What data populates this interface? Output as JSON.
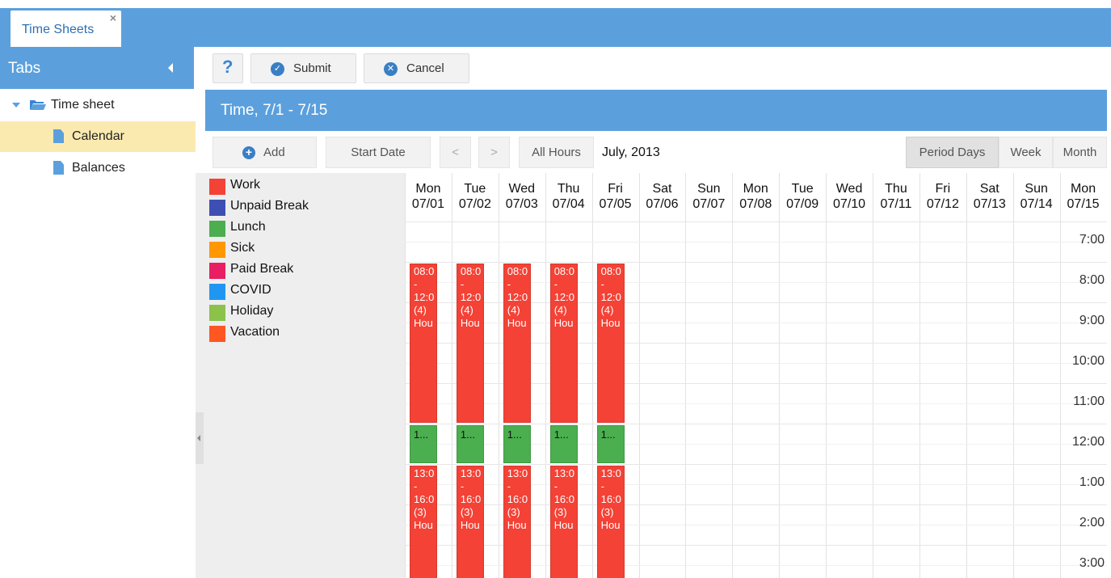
{
  "window": {
    "tab_title": "Time Sheets",
    "tab_close": "×"
  },
  "sidebar": {
    "title": "Tabs",
    "root_label": "Time sheet",
    "items": [
      {
        "label": "Calendar",
        "active": true
      },
      {
        "label": "Balances",
        "active": false
      }
    ]
  },
  "toolbar": {
    "help_label": "?",
    "submit_label": "Submit",
    "cancel_label": "Cancel"
  },
  "period": {
    "title": "Time, 7/1 - 7/15"
  },
  "calendar_toolbar": {
    "add_label": "Add",
    "start_date_label": "Start Date",
    "prev_label": "<",
    "next_label": ">",
    "all_hours_label": "All Hours",
    "month_label": "July, 2013",
    "views": [
      "Period Days",
      "Week",
      "Month"
    ],
    "active_view": "Period Days"
  },
  "legend": [
    {
      "label": "Work",
      "color": "#f44236"
    },
    {
      "label": "Unpaid Break",
      "color": "#3e4fb4"
    },
    {
      "label": "Lunch",
      "color": "#4bae4f"
    },
    {
      "label": "Sick",
      "color": "#fe9700"
    },
    {
      "label": "Paid Break",
      "color": "#e91e63"
    },
    {
      "label": "COVID",
      "color": "#2096f3"
    },
    {
      "label": "Holiday",
      "color": "#8bc24a"
    },
    {
      "label": "Vacation",
      "color": "#fe5722"
    }
  ],
  "days": [
    {
      "dow": "Mon",
      "date": "07/01"
    },
    {
      "dow": "Tue",
      "date": "07/02"
    },
    {
      "dow": "Wed",
      "date": "07/03"
    },
    {
      "dow": "Thu",
      "date": "07/04"
    },
    {
      "dow": "Fri",
      "date": "07/05"
    },
    {
      "dow": "Sat",
      "date": "07/06"
    },
    {
      "dow": "Sun",
      "date": "07/07"
    },
    {
      "dow": "Mon",
      "date": "07/08"
    },
    {
      "dow": "Tue",
      "date": "07/09"
    },
    {
      "dow": "Wed",
      "date": "07/10"
    },
    {
      "dow": "Thu",
      "date": "07/11"
    },
    {
      "dow": "Fri",
      "date": "07/12"
    },
    {
      "dow": "Sat",
      "date": "07/13"
    },
    {
      "dow": "Sun",
      "date": "07/14"
    },
    {
      "dow": "Mon",
      "date": "07/15"
    }
  ],
  "time_labels": [
    "7:00",
    "8:00",
    "9:00",
    "10:00",
    "11:00",
    "12:00",
    "1:00",
    "2:00",
    "3:00"
  ],
  "first_hour": 7,
  "events": [
    {
      "day": 0,
      "start": 8,
      "end": 12,
      "kind": "work",
      "lines": [
        "08:0",
        "-",
        "12:0",
        "(4)",
        "Hou"
      ]
    },
    {
      "day": 1,
      "start": 8,
      "end": 12,
      "kind": "work",
      "lines": [
        "08:0",
        "-",
        "12:0",
        "(4)",
        "Hou"
      ]
    },
    {
      "day": 2,
      "start": 8,
      "end": 12,
      "kind": "work",
      "lines": [
        "08:0",
        "-",
        "12:0",
        "(4)",
        "Hou"
      ]
    },
    {
      "day": 3,
      "start": 8,
      "end": 12,
      "kind": "work",
      "lines": [
        "08:0",
        "-",
        "12:0",
        "(4)",
        "Hou"
      ]
    },
    {
      "day": 4,
      "start": 8,
      "end": 12,
      "kind": "work",
      "lines": [
        "08:0",
        "-",
        "12:0",
        "(4)",
        "Hou"
      ]
    },
    {
      "day": 0,
      "start": 12,
      "end": 13,
      "kind": "lunch",
      "lines": [
        "1..."
      ]
    },
    {
      "day": 1,
      "start": 12,
      "end": 13,
      "kind": "lunch",
      "lines": [
        "1..."
      ]
    },
    {
      "day": 2,
      "start": 12,
      "end": 13,
      "kind": "lunch",
      "lines": [
        "1..."
      ]
    },
    {
      "day": 3,
      "start": 12,
      "end": 13,
      "kind": "lunch",
      "lines": [
        "1..."
      ]
    },
    {
      "day": 4,
      "start": 12,
      "end": 13,
      "kind": "lunch",
      "lines": [
        "1..."
      ]
    },
    {
      "day": 0,
      "start": 13,
      "end": 16,
      "kind": "work",
      "lines": [
        "13:0",
        "-",
        "16:0",
        "(3)",
        "Hou"
      ]
    },
    {
      "day": 1,
      "start": 13,
      "end": 16,
      "kind": "work",
      "lines": [
        "13:0",
        "-",
        "16:0",
        "(3)",
        "Hou"
      ]
    },
    {
      "day": 2,
      "start": 13,
      "end": 16,
      "kind": "work",
      "lines": [
        "13:0",
        "-",
        "16:0",
        "(3)",
        "Hou"
      ]
    },
    {
      "day": 3,
      "start": 13,
      "end": 16,
      "kind": "work",
      "lines": [
        "13:0",
        "-",
        "16:0",
        "(3)",
        "Hou"
      ]
    },
    {
      "day": 4,
      "start": 13,
      "end": 16,
      "kind": "work",
      "lines": [
        "13:0",
        "-",
        "16:0",
        "(3)",
        "Hou"
      ]
    }
  ]
}
